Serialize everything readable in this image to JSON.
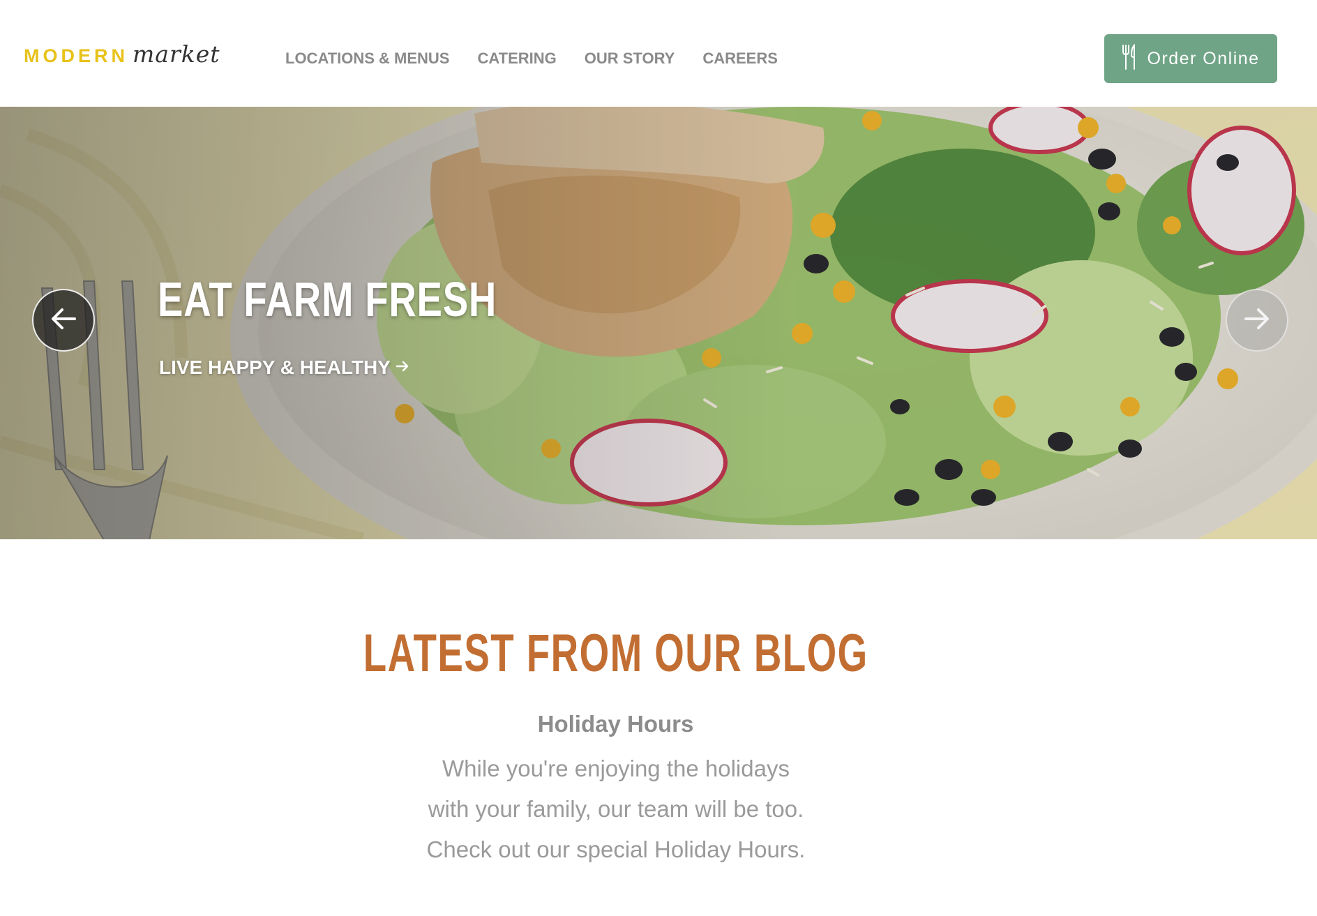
{
  "colors": {
    "logo_modern": "#e8c21a",
    "logo_market": "#333333",
    "nav_text": "#8a8a8a",
    "order_button_bg": "#6fa486",
    "blog_title": "#c26e32",
    "post_title": "#8c8c8c",
    "post_text": "#9a9a9a"
  },
  "header": {
    "logo": {
      "modern": "MODERN",
      "market": "market"
    },
    "nav": [
      {
        "label": "LOCATIONS & MENUS"
      },
      {
        "label": "CATERING"
      },
      {
        "label": "OUR STORY"
      },
      {
        "label": "CAREERS"
      }
    ],
    "order_button": {
      "label": "Order Online",
      "icon": "fork-knife-icon"
    }
  },
  "hero": {
    "title": "EAT FARM FRESH",
    "link_label": "LIVE HAPPY & HEALTHY",
    "prev_icon": "arrow-left-icon",
    "next_icon": "arrow-right-icon"
  },
  "blog": {
    "heading": "LATEST FROM OUR BLOG",
    "post": {
      "title": "Holiday Hours",
      "excerpt": "While you're enjoying the holidays with your family, our team will be too. Check out our special Holiday Hours."
    }
  }
}
